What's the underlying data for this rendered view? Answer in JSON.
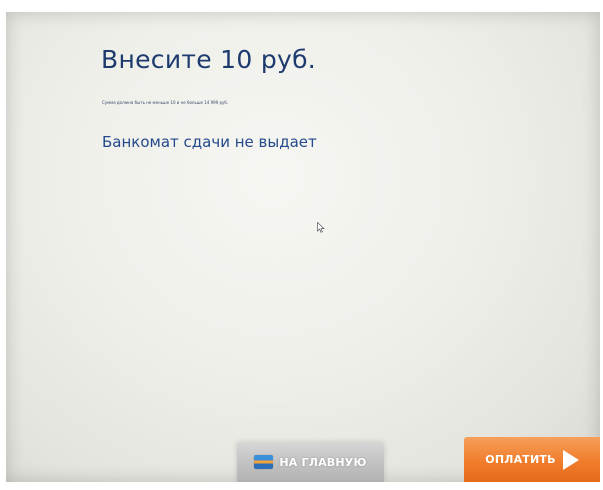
{
  "screen": {
    "heading": "Внесите 10 руб.",
    "limit_note": "Сумма должна быть не меньше 10 и не больше 14 999 руб.",
    "no_change_notice": "Банкомат сдачи не выдает"
  },
  "footer": {
    "home_label": "НА ГЛАВНУЮ",
    "pay_label": "ОПЛАТИТЬ"
  },
  "icons": {
    "home": "bank-card-icon",
    "pay": "play-arrow-icon",
    "pointer": "mouse-cursor-icon"
  },
  "colors": {
    "heading": "#1d3a6e",
    "notice": "#24498a",
    "pay_button": "#f07d2c",
    "home_button": "#c3c3c3"
  }
}
